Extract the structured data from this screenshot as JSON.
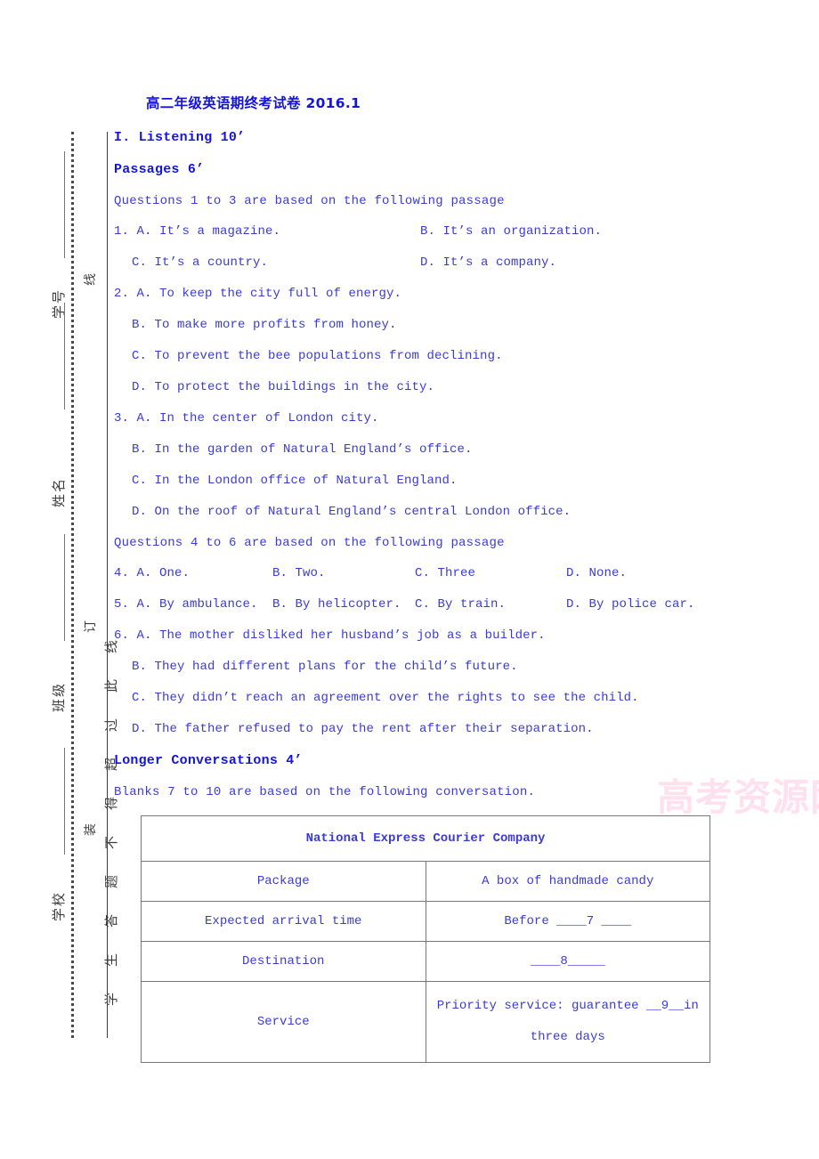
{
  "document": {
    "title": "高二年级英语期终考试卷 2016.1",
    "watermark": "高考资源网"
  },
  "margin": {
    "warning_text": "学生答题不得超过此线",
    "seal_marks": [
      "线",
      "订",
      "装"
    ],
    "fields": [
      {
        "label": "学号"
      },
      {
        "label": "姓名"
      },
      {
        "label": "班级"
      },
      {
        "label": "学校"
      }
    ]
  },
  "sections": {
    "listening_heading": "I. Listening 10’",
    "passages_heading": "Passages 6’",
    "longer_conversations_heading": "Longer Conversations 4’",
    "lead_1_3": "Questions 1 to 3 are based on the following passage",
    "lead_4_6": "Questions 4 to 6 are based on the following passage",
    "lead_7_10": "Blanks 7 to 10 are based on the following conversation."
  },
  "questions": [
    {
      "id": "q1",
      "line1": "1. A. It’s a magazine.",
      "line1b": "B. It’s an organization.",
      "line2": "C. It’s a country.",
      "line2b": "D. It’s a company."
    },
    {
      "id": "q2",
      "a": "2. A. To keep the city full of energy.",
      "b": "B. To make more profits from honey.",
      "c": "C. To prevent the bee populations from declining.",
      "d": "D. To protect the buildings in the city."
    },
    {
      "id": "q3",
      "a": "3. A. In the center of London city.",
      "b": "B. In the garden of Natural England’s office.",
      "c": "C. In the London office of Natural England.",
      "d": "D. On the roof of Natural England’s central London office."
    },
    {
      "id": "q4",
      "a": "4. A. One.",
      "b": "B. Two.",
      "c": "C. Three",
      "d": "D. None."
    },
    {
      "id": "q5",
      "a": "5. A. By ambulance.",
      "b": "B. By helicopter.",
      "c": "C. By train.",
      "d": "D. By police car."
    },
    {
      "id": "q6",
      "a": "6. A. The mother disliked her husband’s job as a builder.",
      "b": "B. They had different plans for the child’s future.",
      "c": "C. They didn’t reach an agreement over the rights to see the child.",
      "d": "D. The father refused to pay the rent after their separation."
    }
  ],
  "table": {
    "header": "National Express Courier Company",
    "rows": [
      {
        "label": "Package",
        "value": "A box of handmade candy"
      },
      {
        "label": "Expected arrival time",
        "value": "Before  ____7 ____"
      },
      {
        "label": "Destination",
        "value": "____8_____"
      },
      {
        "label": "Service",
        "value_line1": "Priority  service:  guarantee  __9__in",
        "value_line2": "three days"
      }
    ]
  },
  "colors": {
    "heading_blue": "#1414dd",
    "body_blue": "#3a3ad8",
    "rule_gray": "#3a3a3a",
    "watermark_pink": "#ffd7e8"
  }
}
